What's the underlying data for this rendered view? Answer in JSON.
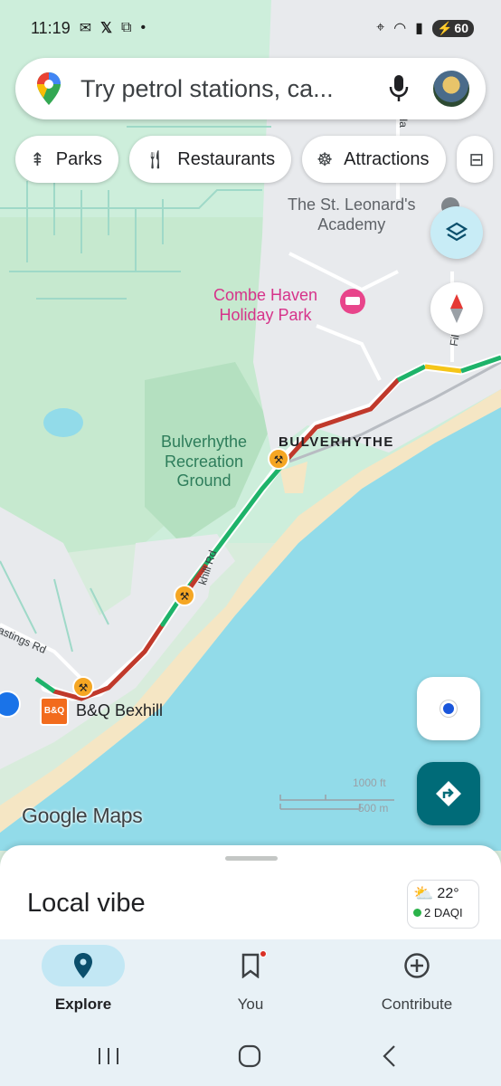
{
  "status_bar": {
    "time": "11:19",
    "dot": "•",
    "battery": "60"
  },
  "search": {
    "placeholder": "Try petrol stations, ca..."
  },
  "chips": [
    {
      "label": "Parks",
      "icon": "tree-icon"
    },
    {
      "label": "Restaurants",
      "icon": "fork-knife-icon"
    },
    {
      "label": "Attractions",
      "icon": "ferris-wheel-icon"
    }
  ],
  "map": {
    "labels": {
      "academy_line1": "The St. Leonard's",
      "academy_line2": "Academy",
      "holiday_line1": "Combe Haven",
      "holiday_line2": "Holiday Park",
      "recreation_line1": "Bulverhythe",
      "recreation_line2": "Recreation",
      "recreation_line3": "Ground",
      "place": "BULVERHYTHE",
      "store": "B&Q Bexhill",
      "store_logo": "B&Q",
      "road_1": "khill Rd",
      "road_2": "astings Rd",
      "road_3": "Fils",
      "road_4": "Rd",
      "road_5": "Ha"
    },
    "scale": {
      "feet": "1000 ft",
      "meters": "500 m"
    },
    "colors": {
      "land": "#d8ecdc",
      "park": "#bfe3c9",
      "urban": "#e8eaed",
      "water": "#92dbe9",
      "beach": "#f5e6c4",
      "traffic_red": "#c0392b",
      "traffic_green": "#1eb36a",
      "traffic_yellow": "#f5c518"
    },
    "attribution": "Google Maps"
  },
  "bottom_sheet": {
    "title": "Local vibe",
    "weather": {
      "temp": "22°",
      "aqi": "2 DAQI"
    }
  },
  "bottom_nav": [
    {
      "label": "Explore",
      "active": true
    },
    {
      "label": "You",
      "active": false
    },
    {
      "label": "Contribute",
      "active": false
    }
  ]
}
